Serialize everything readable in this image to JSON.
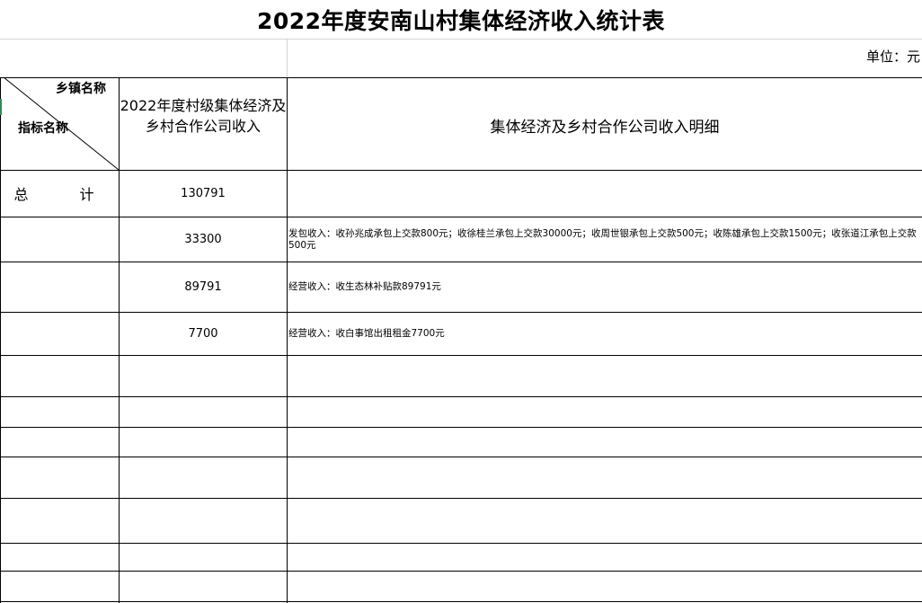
{
  "title": "2022年度安南山村集体经济收入统计表",
  "unit": "单位：元",
  "header": {
    "town_label": "乡镇名称",
    "index_label": "指标名称",
    "col_income": "2022年度村级集体经济及乡村合作公司收入",
    "col_detail": "集体经济及乡村合作公司收入明细"
  },
  "total": {
    "label": "总 计",
    "value": "130791",
    "detail": ""
  },
  "rows": [
    {
      "value": "33300",
      "detail": "发包收入：收孙兆成承包上交款800元；收徐桂兰承包上交款30000元；收周世银承包上交款500元；收陈雄承包上交款1500元；收张道江承包上交款500元"
    },
    {
      "value": "89791",
      "detail": "经营收入：收生态林补贴款89791元"
    },
    {
      "value": "7700",
      "detail": "经营收入：收白事馆出租租金7700元"
    }
  ]
}
